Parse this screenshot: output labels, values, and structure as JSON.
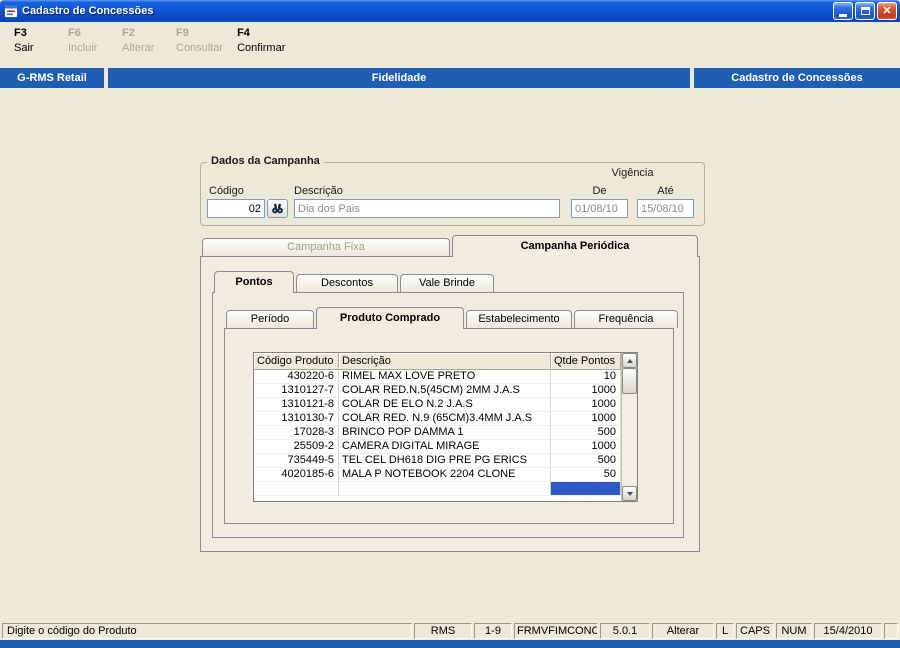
{
  "window": {
    "title": "Cadastro de Concessões"
  },
  "toolbar": {
    "buttons": [
      {
        "key": "F3",
        "label": "Sair",
        "enabled": true
      },
      {
        "key": "F6",
        "label": "Incluir",
        "enabled": false
      },
      {
        "key": "F2",
        "label": "Alterar",
        "enabled": false
      },
      {
        "key": "F9",
        "label": "Consultar",
        "enabled": false
      },
      {
        "key": "F4",
        "label": "Confirmar",
        "enabled": true
      }
    ]
  },
  "header": {
    "left": "G-RMS Retail",
    "center": "Fidelidade",
    "right": "Cadastro de Concessões"
  },
  "campaign": {
    "group_title": "Dados da Campanha",
    "vigencia_label": "Vigência",
    "codigo_label": "Código",
    "codigo_value": "02",
    "descricao_label": "Descrição",
    "descricao_value": "Dia dos Pais",
    "de_label": "De",
    "de_value": "01/08/10",
    "ate_label": "Até",
    "ate_value": "15/08/10"
  },
  "tabs_outer": [
    {
      "label": "Campanha Fixa",
      "active": false,
      "enabled": false
    },
    {
      "label": "Campanha Periódica",
      "active": true,
      "enabled": true
    }
  ],
  "tabs_mid": [
    {
      "label": "Pontos",
      "active": true
    },
    {
      "label": "Descontos",
      "active": false
    },
    {
      "label": "Vale Brinde",
      "active": false
    }
  ],
  "tabs_inner": [
    {
      "label": "Período",
      "active": false
    },
    {
      "label": "Produto Comprado",
      "active": true
    },
    {
      "label": "Estabelecimento",
      "active": false
    },
    {
      "label": "Frequência",
      "active": false
    }
  ],
  "grid": {
    "columns": [
      "Código Produto",
      "Descrição",
      "Qtde Pontos"
    ],
    "rows": [
      [
        "430220-6",
        "RIMEL MAX LOVE PRETO",
        "10"
      ],
      [
        "1310127-7",
        "COLAR RED.N.5(45CM) 2MM J.A.S",
        "1000"
      ],
      [
        "1310121-8",
        "COLAR DE ELO N.2 J.A.S",
        "1000"
      ],
      [
        "1310130-7",
        "COLAR RED. N.9 (65CM)3.4MM J.A.S",
        "1000"
      ],
      [
        "17028-3",
        "BRINCO POP DAMMA  1",
        "500"
      ],
      [
        "25509-2",
        "CAMERA DIGITAL MIRAGE",
        "1000"
      ],
      [
        "735449-5",
        "TEL CEL DH618 DIG PRE PG ERICS",
        "500"
      ],
      [
        "4020185-6",
        "MALA P NOTEBOOK 2204 CLONE",
        "50"
      ]
    ],
    "selected_row_index": 8,
    "selected_column": "Qtde Pontos"
  },
  "statusbar": {
    "message": "Digite o código do Produto",
    "panels": [
      "RMS",
      "1-9",
      "FRMVFIMCONC",
      "5.0.1",
      "Alterar",
      "L",
      "CAPS",
      "NUM",
      "15/4/2010"
    ]
  },
  "colors": {
    "header_blue": "#1e5fb4",
    "selection_blue": "#2e58c8",
    "window_bg": "#ece9d8",
    "titlebar_blue": "#0f55d8",
    "close_button_red": "#c43a18"
  }
}
